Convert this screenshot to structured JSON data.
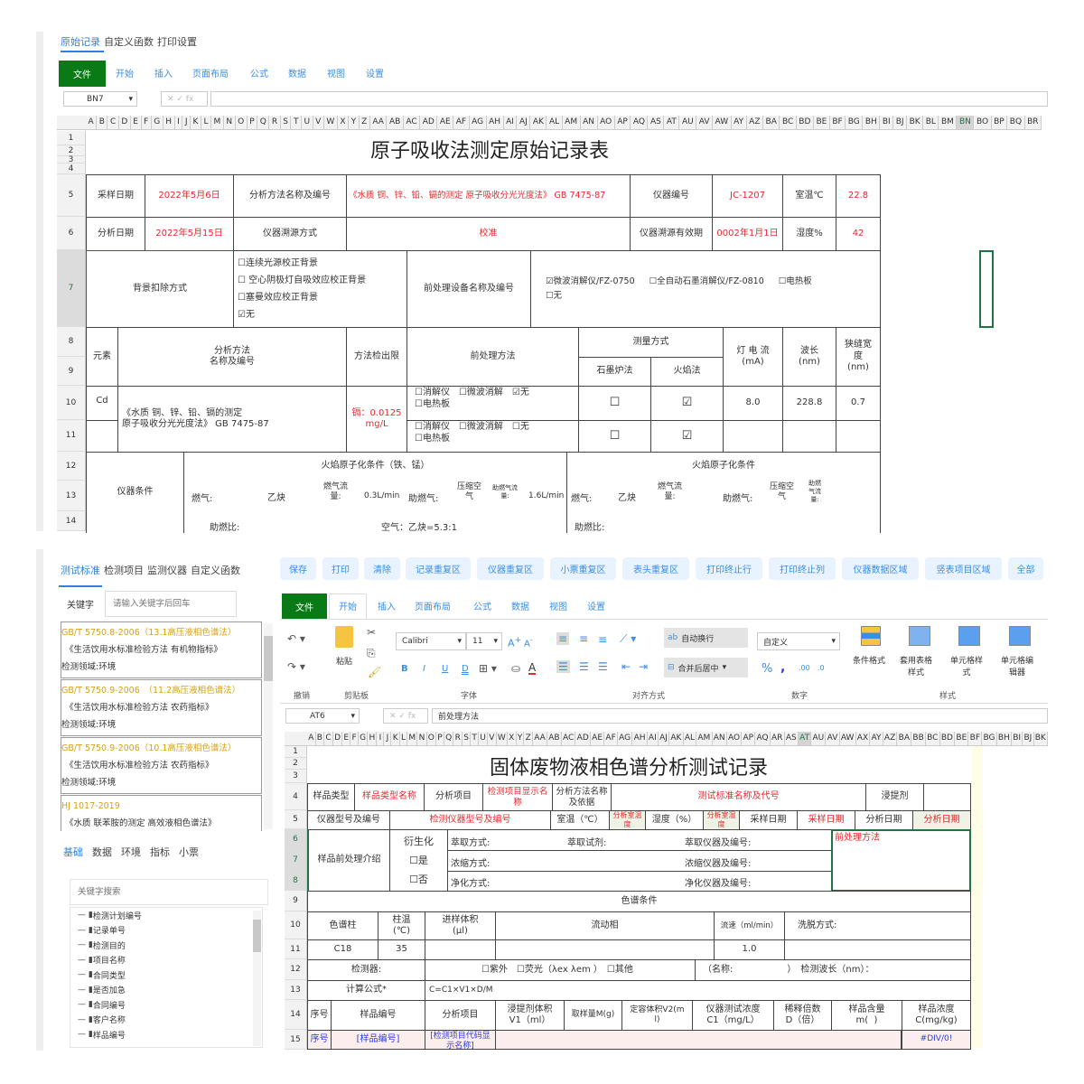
{
  "top": {
    "tabs": [
      "原始记录",
      "自定义函数",
      "打印设置"
    ],
    "ribbon_tabs": [
      "文件",
      "开始",
      "插入",
      "页面布局",
      "公式",
      "数据",
      "视图",
      "设置"
    ],
    "name_box": "BN7",
    "formula_icons": "✕ ✓ fx",
    "columns": [
      "A",
      "B",
      "C",
      "D",
      "E",
      "F",
      "G",
      "H",
      "I",
      "J",
      "K",
      "L",
      "M",
      "N",
      "O",
      "P",
      "Q",
      "R",
      "S",
      "T",
      "U",
      "V",
      "W",
      "X",
      "Y",
      "Z",
      "AA",
      "AB",
      "AC",
      "AD",
      "AE",
      "AF",
      "AG",
      "AH",
      "AI",
      "AJ",
      "AK",
      "AL",
      "AM",
      "AN",
      "AO",
      "AP",
      "AQ",
      "AS",
      "AT",
      "AU",
      "AV",
      "AW",
      "AY",
      "AZ",
      "BA",
      "BC",
      "BD",
      "BE",
      "BF",
      "BG",
      "BH",
      "BI",
      "BJ",
      "BK",
      "BL",
      "BM",
      "BN",
      "BO",
      "BP",
      "BQ",
      "BR"
    ],
    "rows": [
      "1",
      "2",
      "3",
      "4",
      "5",
      "6",
      "7",
      "8",
      "9",
      "10",
      "11",
      "12",
      "13",
      "14"
    ],
    "sheet": {
      "title": "原子吸收法测定原始记录表",
      "r5": [
        "采样日期",
        "2022年5月6日",
        "分析方法名称及编号",
        "《水质 铜、锌、铅、镉的测定 原子吸收分光光度法》 GB 7475-87",
        "仪器编号",
        "JC-1207",
        "室温℃",
        "22.8"
      ],
      "r6": [
        "分析日期",
        "2022年5月15日",
        "仪器溯源方式",
        "校准",
        "仪器溯源有效期",
        "0002年1月1日",
        "湿度%",
        "42"
      ],
      "r7_label": "背景扣除方式",
      "r7_bg_options": [
        "☐连续光源校正背景",
        "☐ 空心阴极灯自吸效应校正背景",
        "☐塞曼效应校正背景",
        "☑无"
      ],
      "r7_device_label": "前处理设备名称及编号",
      "r7_devices": [
        "☑微波消解仪/FZ-0750",
        "☐全自动石墨消解仪/FZ-0810",
        "☐电热板",
        "☐无"
      ],
      "hdr": [
        "元素",
        "分析方法\n名称及编号",
        "方法检出限",
        "前处理方法",
        "测量方式",
        "石墨炉法",
        "火焰法",
        "灯 电 流\n(mA)",
        "波长\n(nm)",
        "狭缝宽\n度\n(nm)"
      ],
      "r10": {
        "element": "Cd",
        "method": "《水质 铜、锌、铅、镉的测定\n原子吸收分光光度法》 GB 7475-87",
        "limit": "镉：0.0125\nmg/L",
        "pre": "☐消解仪　☐微波消解　☑无\n☐电热板",
        "graphite": "☐",
        "flame": "☑",
        "current": "8.0",
        "wavelength": "228.8",
        "slit": "0.7"
      },
      "r11": {
        "pre": "☐消解仪　☐微波消解　☐无\n☐电热板",
        "graphite": "☐",
        "flame": "☑"
      },
      "instr_label": "仪器条件",
      "flame1_title": "火焰原子化条件（铁、锰）",
      "flame2_title": "火焰原子化条件",
      "flame1": [
        "燃气:",
        "乙炔",
        "燃气流\n量:",
        "0.3L/min",
        "助燃气:",
        "压缩空\n气",
        "助燃气流\n量:",
        "1.6L/min"
      ],
      "flame1_r14": [
        "助燃比:",
        "空气：乙炔=5.3:1"
      ],
      "flame2": [
        "燃气:",
        "乙炔",
        "燃气流\n量:",
        "助燃气:",
        "压缩空\n气",
        "助燃\n气流\n量:"
      ],
      "flame2_r14": [
        "助燃比:"
      ]
    }
  },
  "bottom": {
    "sidebar": {
      "tabs": [
        "测试标准",
        "检测项目",
        "监测仪器",
        "自定义函数"
      ],
      "keyword_label": "关键字",
      "keyword_placeholder": "请输入关键字后回车",
      "cards": [
        {
          "code": "GB/T 5750.8-2006（13.1高压液相色谱法）",
          "name": "《生活饮用水标准检验方法 有机物指标》",
          "field": "检测领域:环境"
        },
        {
          "code": "GB/T 5750.9-2006　（11.2高压液相色谱法）",
          "name": "《生活饮用水标准检验方法 农药指标》",
          "field": "检测领域:环境"
        },
        {
          "code": "GB/T 5750.9-2006（10.1高压液相色谱法）",
          "name": "《生活饮用水标准检验方法 农药指标》",
          "field": "检测领域:环境"
        },
        {
          "code": "HJ 1017-2019",
          "name": "《水质 联苯胺的测定 高效液相色谱法》",
          "field": ""
        }
      ],
      "bottom_tabs": [
        "基础",
        "数据",
        "环境",
        "指标",
        "小票"
      ],
      "search_placeholder": "关键字搜索",
      "tree": [
        "检测计划编号",
        "记录单号",
        "检测目的",
        "项目名称",
        "合同类型",
        "是否加急",
        "合同编号",
        "客户名称",
        "样品编号"
      ]
    },
    "buttons": [
      "保存",
      "打印",
      "清除",
      "记录重复区",
      "仪器重复区",
      "小票重复区",
      "表头重复区",
      "打印终止行",
      "打印终止列",
      "仪器数据区域",
      "竖表项目区域",
      "全部"
    ],
    "ribbon_tabs": [
      "文件",
      "开始",
      "插入",
      "页面布局",
      "公式",
      "数据",
      "视图",
      "设置"
    ],
    "ribbon": {
      "undo_group": "撤销",
      "clipboard_group": "剪贴板",
      "paste": "粘贴",
      "font_group": "字体",
      "font": "Calibri",
      "size": "11",
      "align_group": "对齐方式",
      "wrap": "自动换行",
      "merge": "合并后居中",
      "number_group": "数字",
      "number_format": "自定义",
      "style_group": "样式",
      "styles": [
        "条件格式",
        "套用表格\n样式",
        "单元格样\n式",
        "单元格编\n辑器"
      ]
    },
    "name_box": "AT6",
    "formula_value": "前处理方法",
    "columns": [
      "A",
      "B",
      "C",
      "D",
      "E",
      "F",
      "G",
      "H",
      "I",
      "J",
      "K",
      "L",
      "M",
      "N",
      "O",
      "P",
      "Q",
      "R",
      "S",
      "T",
      "U",
      "V",
      "W",
      "X",
      "Y",
      "Z",
      "AA",
      "AB",
      "AC",
      "AD",
      "AE",
      "AF",
      "AG",
      "AH",
      "AI",
      "AJ",
      "AK",
      "AL",
      "AM",
      "AN",
      "AO",
      "AP",
      "AQ",
      "AR",
      "AS",
      "AT",
      "AU",
      "AV",
      "AW",
      "AX",
      "AY",
      "AZ",
      "BA",
      "BB",
      "BC",
      "BD",
      "BE",
      "BF",
      "BG",
      "BH",
      "BI",
      "BJ",
      "BK"
    ],
    "rows": [
      "1",
      "2",
      "3",
      "4",
      "5",
      "6",
      "7",
      "8",
      "9",
      "10",
      "11",
      "12",
      "13",
      "14",
      "15"
    ],
    "sheet": {
      "title": "固体废物液相色谱分析测试记录",
      "r4": [
        "样品类型",
        "样品类型名称",
        "分析项目",
        "检测项目显示名称",
        "分析方法名称及依据",
        "测试标准名称及代号",
        "浸提剂",
        ""
      ],
      "r5": [
        "仪器型号及编号",
        "检测仪器型号及编号",
        "室温（℃）",
        "分析室温度",
        "湿度（%）",
        "分析室湿度",
        "采样日期",
        "采样日期",
        "分析日期",
        "分析日期"
      ],
      "pre_label": "样品前处理介绍",
      "deriv": [
        "衍生化",
        "☐是",
        "☐否"
      ],
      "r6": [
        "萃取方式:",
        "萃取试剂:",
        "萃取仪器及编号:"
      ],
      "r7": [
        "浓缩方式:",
        "浓缩仪器及编号:"
      ],
      "r8": [
        "净化方式:",
        "净化仪器及编号:"
      ],
      "pre_method": "前处理方法",
      "r9": "色谱条件",
      "r10": [
        "色谱柱",
        "柱温\n(℃)",
        "进样体积\n(μl)",
        "流动相",
        "流速（ml/min）",
        "洗脱方式:"
      ],
      "r11": [
        "C18",
        "35",
        "",
        "",
        "1.0",
        ""
      ],
      "r12": [
        "检测器:",
        "☐紫外　☐荧光（λex λem ）　☐其他",
        "（名称:　　　　　　）　检测波长（nm）："
      ],
      "r13": [
        "计算公式*",
        "C=C1×V1×D/M"
      ],
      "r14": [
        "序号",
        "样品编号",
        "分析项目",
        "浸提剂体积\nV1（ml）",
        "取样量M(g)",
        "定容体积V2(m\nl)",
        "仪器测试浓度\nC1（mg/L）",
        "稀释倍数\nD（倍）",
        "样品含量\nm(  )",
        "样品浓度\nC(mg/kg)"
      ],
      "r15": [
        "序号",
        "[样品编号]",
        "[检测项目代码显示名称]",
        "#DIV/0!"
      ]
    }
  },
  "colors": {
    "accent": "#2f7fe0",
    "file_tab": "#0a7a16",
    "red_text": "#e8282e",
    "blue_text": "#2a3de8",
    "card_code": "#d4a017"
  }
}
